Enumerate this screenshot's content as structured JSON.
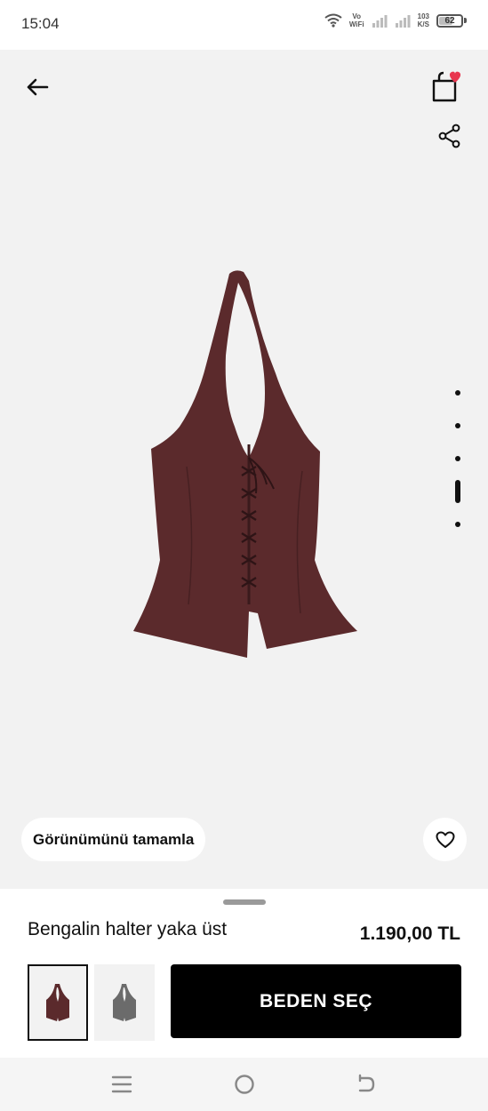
{
  "status_bar": {
    "time": "15:04",
    "wifi_icon": "wifi-icon",
    "network_top": "Vo",
    "network_bottom": "WiFi",
    "speed_value": "103",
    "speed_unit": "K/S",
    "battery_level": "62",
    "battery_fraction": 0.62
  },
  "header": {
    "back_icon": "arrow-left-icon",
    "cart_icon": "shopping-bag-icon",
    "cart_badge_icon": "heart-icon",
    "cart_badge_color": "#e8364f",
    "share_icon": "share-icon"
  },
  "product_image": {
    "icon": "halter-vest-image",
    "color": "#5b2a2c"
  },
  "gallery": {
    "total_images": 5,
    "active_index": 3
  },
  "complete_look": {
    "label": "Görünümünü tamamla"
  },
  "favorite": {
    "icon": "heart-outline-icon"
  },
  "product": {
    "name": "Bengalin halter yaka üst",
    "price": "1.190,00 TL"
  },
  "variants": [
    {
      "color": "#5b2a2c",
      "selected": true,
      "icon": "vest-thumbnail-burgundy"
    },
    {
      "color": "#6b6b6b",
      "selected": false,
      "icon": "vest-thumbnail-gray"
    }
  ],
  "actions": {
    "select_size_label": "BEDEN SEÇ"
  },
  "nav_bar": {
    "menu_icon": "menu-icon",
    "home_icon": "home-circle-icon",
    "back_icon": "back-icon"
  }
}
